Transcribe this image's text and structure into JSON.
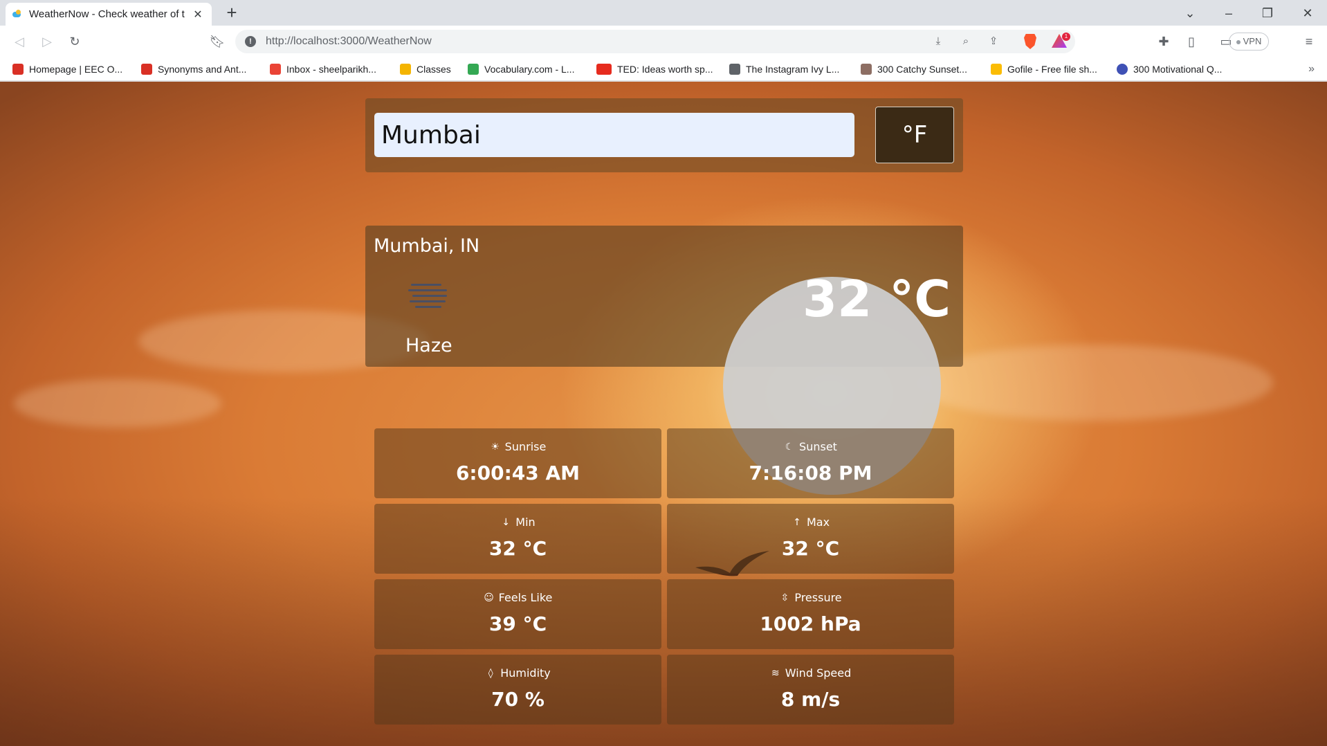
{
  "browser": {
    "tab_title": "WeatherNow - Check weather of t",
    "url": "http://localhost:3000/WeatherNow",
    "vpn_label": "VPN",
    "notification_count": "1",
    "bookmarks": [
      {
        "label": "Homepage | EEC O...",
        "color": "#d93025"
      },
      {
        "label": "Synonyms and Ant...",
        "color": "#d93025"
      },
      {
        "label": "Inbox - sheelparikh...",
        "color": "#ea4335"
      },
      {
        "label": "Classes",
        "color": "#f4b400"
      },
      {
        "label": "Vocabulary.com - L...",
        "color": "#34a853"
      },
      {
        "label": "TED: Ideas worth sp...",
        "color": "#e62b1e"
      },
      {
        "label": "The Instagram Ivy L...",
        "color": "#5f6368"
      },
      {
        "label": "300 Catchy Sunset...",
        "color": "#8d6e63"
      },
      {
        "label": "Gofile - Free file sh...",
        "color": "#fbbc04"
      },
      {
        "label": "300 Motivational Q...",
        "color": "#3f51b5"
      }
    ]
  },
  "search": {
    "city_value": "Mumbai",
    "unit_toggle_label": "°F"
  },
  "current": {
    "location": "Mumbai, IN",
    "condition": "Haze",
    "condition_icon": "haze-icon",
    "temperature": "32 °C"
  },
  "stats": [
    {
      "label": "Sunrise",
      "value": "6:00:43 AM",
      "icon": "sun-icon"
    },
    {
      "label": "Sunset",
      "value": "7:16:08 PM",
      "icon": "moon-icon"
    },
    {
      "label": "Min",
      "value": "32 °C",
      "icon": "arrow-down-icon"
    },
    {
      "label": "Max",
      "value": "32 °C",
      "icon": "arrow-up-icon"
    },
    {
      "label": "Feels Like",
      "value": "39 °C",
      "icon": "smile-icon"
    },
    {
      "label": "Pressure",
      "value": "1002 hPa",
      "icon": "pressure-icon"
    },
    {
      "label": "Humidity",
      "value": "70 %",
      "icon": "droplet-icon"
    },
    {
      "label": "Wind Speed",
      "value": "8 m/s",
      "icon": "wind-icon"
    }
  ]
}
